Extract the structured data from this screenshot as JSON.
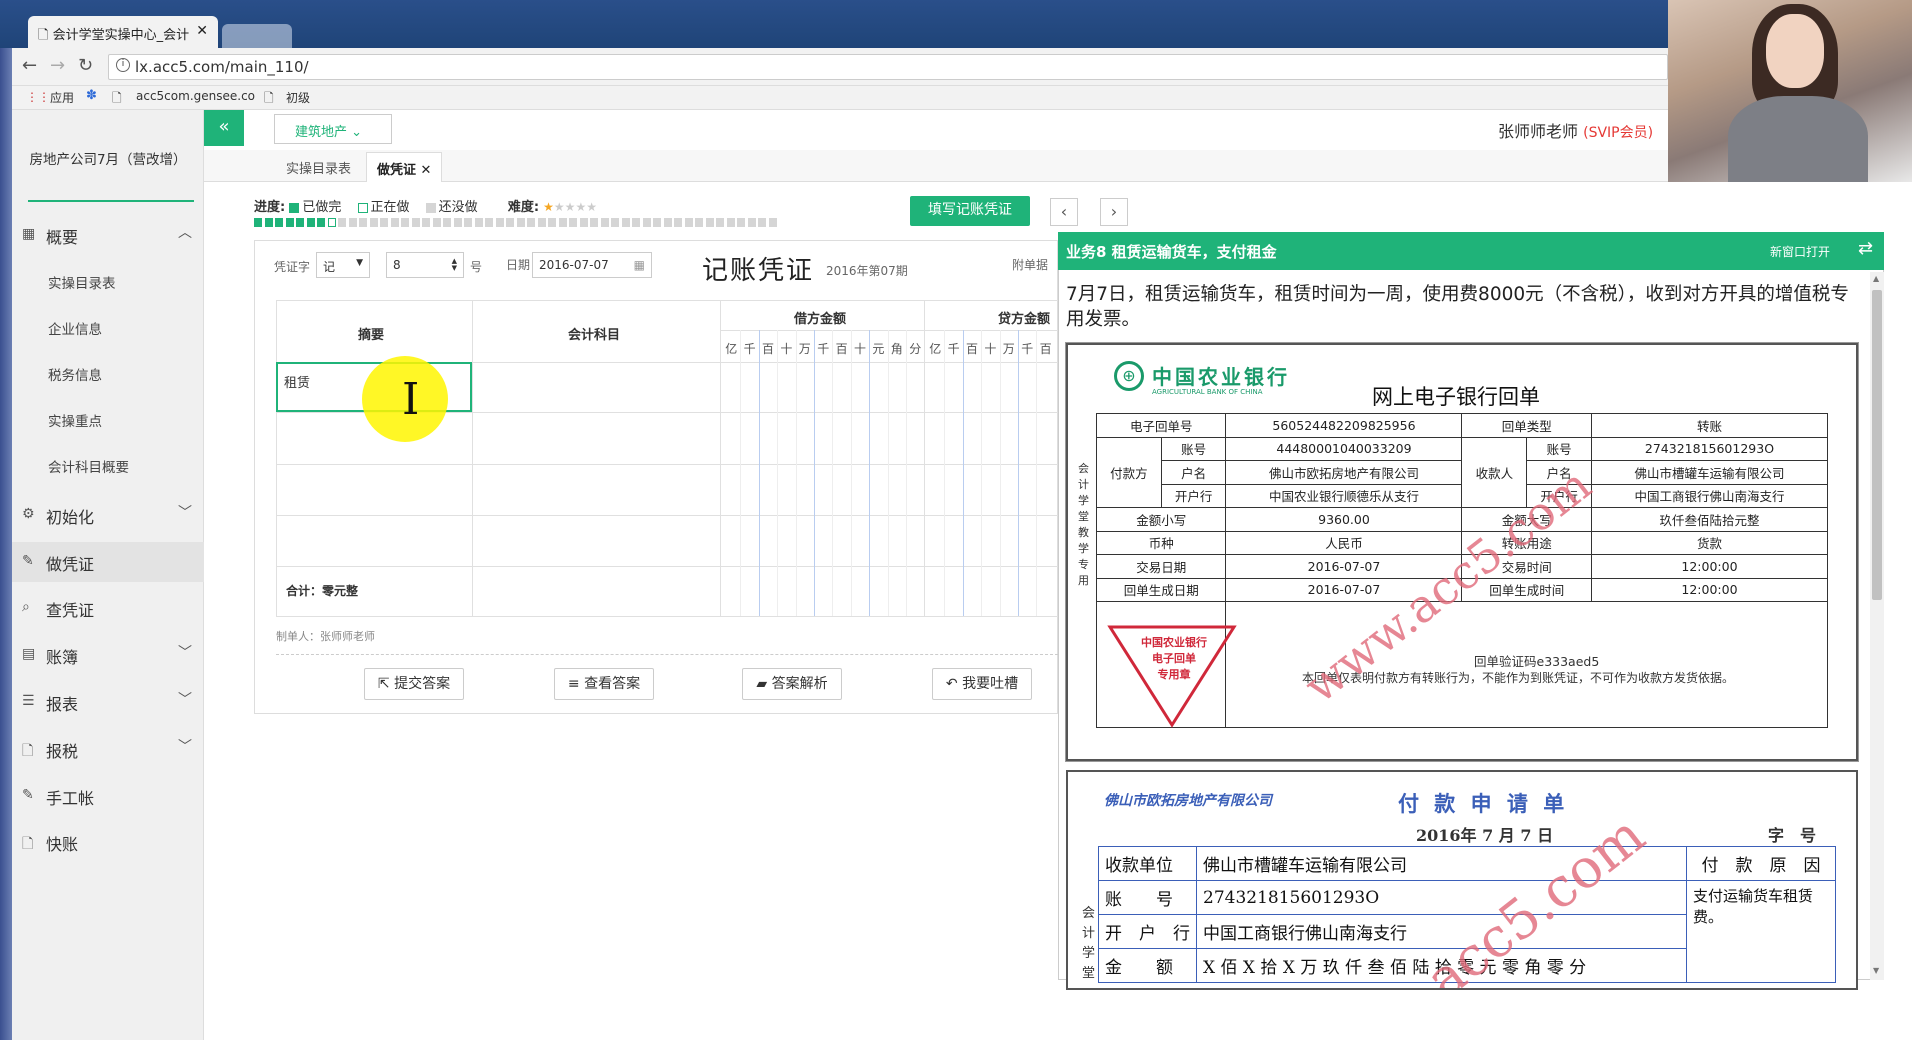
{
  "browser": {
    "tab_title": "会计学堂实操中心_会计",
    "url": "lx.acc5.com/main_110/",
    "bookmarks": [
      "应用",
      "acc5com.gensee.co",
      "初级"
    ]
  },
  "sidebar": {
    "company": "房地产公司7月（营改增）",
    "overview": "概要",
    "sub": [
      "实操目录表",
      "企业信息",
      "税务信息",
      "实操重点",
      "会计科目概要"
    ],
    "groups": [
      "初始化",
      "做凭证",
      "查凭证",
      "账簿",
      "报表",
      "报税",
      "手工帐",
      "快账"
    ]
  },
  "header": {
    "dropdown": "建筑地产",
    "user": "张师师老师",
    "vip": "(SVIP会员)"
  },
  "tabs": {
    "t1": "实操目录表",
    "t2": "做凭证"
  },
  "progress": {
    "label": "进度:",
    "done": "已做完",
    "doing": "正在做",
    "todo": "还没做",
    "difficulty": "难度:",
    "done_count": 7,
    "current_index": 7,
    "total": 50
  },
  "toolbar": {
    "fill": "填写记账凭证"
  },
  "voucher": {
    "zi_label": "凭证字",
    "zi": "记",
    "no": "8",
    "hao": "号",
    "date_label": "日期",
    "date": "2016-07-07",
    "title": "记账凭证",
    "period": "2016年第07期",
    "attach": "附单据",
    "col_summary": "摘要",
    "col_subject": "会计科目",
    "col_debit": "借方金额",
    "col_credit": "贷方金额",
    "digits": [
      "亿",
      "千",
      "百",
      "十",
      "万",
      "千",
      "百",
      "十",
      "元",
      "角",
      "分"
    ],
    "credit_digits": [
      "亿",
      "千",
      "百",
      "十",
      "万",
      "千",
      "百"
    ],
    "row1": "租赁",
    "total": "合计：零元整",
    "maker": "制单人：张师师老师"
  },
  "actions": {
    "submit": "提交答案",
    "view": "查看答案",
    "analysis": "答案解析",
    "complain": "我要吐槽"
  },
  "panel": {
    "title": "业务8 租赁运输货车，支付租金",
    "open": "新窗口打开",
    "task": "7月7日，租赁运输货车，租赁时间为一周，使用费8000元（不含税），收到对方开具的增值税专用发票。"
  },
  "receipt": {
    "bank": "中国农业银行",
    "bank_en": "AGRICULTURAL BANK OF CHINA",
    "title": "网上电子银行回单",
    "side": "会计学堂教学专用",
    "rows": [
      [
        "电子回单号",
        "560524482209825956",
        "回单类型",
        "转账"
      ],
      [
        "付款方",
        "账号",
        "44480001040033209",
        "收款人",
        "账号",
        "274321815601293O"
      ],
      [
        "户名",
        "佛山市欧拓房地产有限公司",
        "户名",
        "佛山市槽罐车运输有限公司"
      ],
      [
        "开户行",
        "中国农业银行顺德乐从支行",
        "开户行",
        "中国工商银行佛山南海支行"
      ],
      [
        "金额小写",
        "9360.00",
        "金额大写",
        "玖仟叁佰陆拾元整"
      ],
      [
        "币种",
        "人民币",
        "转账用途",
        "货款"
      ],
      [
        "交易日期",
        "2016-07-07",
        "交易时间",
        "12:00:00"
      ],
      [
        "回单生成日期",
        "2016-07-07",
        "回单生成时间",
        "12:00:00"
      ]
    ],
    "stamp": [
      "中国农业银行",
      "电子回单",
      "专用章"
    ],
    "verify": "回单验证码e333aed5",
    "note": "本回单仅表明付款方有转账行为，不能作为到账凭证，不可作为收款方发货依据。",
    "watermark": "www.acc5.com"
  },
  "payreq": {
    "company": "佛山市欧拓房地产有限公司",
    "title": "付 款 申 请 单",
    "date": "2016年 7 月 7 日",
    "zihao": "字　号",
    "side": "会计学堂",
    "payee_l": "收款单位",
    "payee": "佛山市槽罐车运输有限公司",
    "reason_l": "付　款　原　因",
    "acct_l": "账　　号",
    "acct": "274321815601293O",
    "reason": "支付运输货车租赁费。",
    "bank_l": "开　户　行",
    "bank": "中国工商银行佛山南海支行",
    "amt_l": "金　　额",
    "amt": "X 佰 X 拾 X 万 玖 仟 叁 佰 陆 拾 零 元 零 角 零 分",
    "watermark": "acc5.com"
  }
}
